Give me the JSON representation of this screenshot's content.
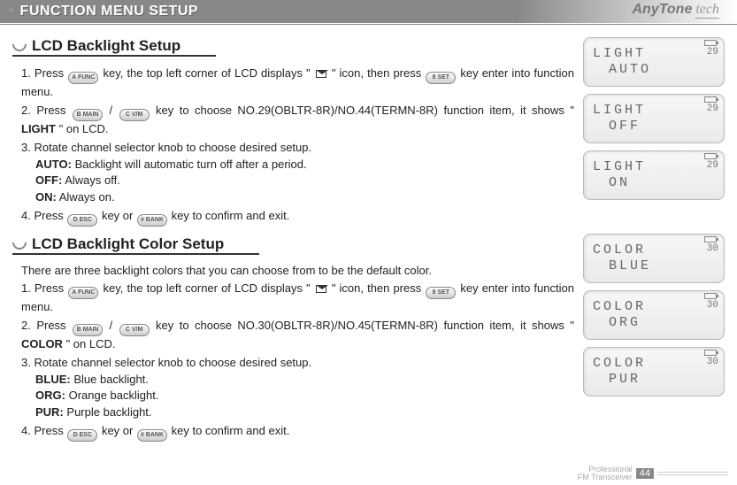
{
  "header": {
    "title": "FUNCTION MENU SETUP",
    "brand_main": "AnyTone",
    "brand_sub": "tech"
  },
  "section1": {
    "title": "LCD Backlight Setup",
    "steps": [
      {
        "num": "1.",
        "pre": "Press ",
        "key1": "A FUNC",
        "mid": " key, the top left corner of LCD displays \" ",
        "post": " \" icon, then press ",
        "key2": "8 SET",
        "tail": " key enter into function menu."
      },
      {
        "num": "2.",
        "pre": "Press ",
        "key1": "B MAIN",
        "sep": " / ",
        "key2": "C V/M",
        "post": " key to choose NO.29(OBLTR-8R)/NO.44(TERMN-8R) function item, it shows \"",
        "bold": "LIGHT",
        "tail": "\" on LCD."
      },
      {
        "num": "3.",
        "text": "Rotate channel selector knob to choose desired setup."
      },
      {
        "label": "AUTO:",
        "text": " Backlight will automatic turn off after a period."
      },
      {
        "label": "OFF:",
        "text": " Always off."
      },
      {
        "label": "ON:",
        "text": " Always on."
      },
      {
        "num": "4.",
        "pre": "Press ",
        "key1": "D ESC",
        "mid": " key or ",
        "key2": "# BANK",
        "tail": " key to confirm and exit."
      }
    ]
  },
  "section2": {
    "title": "LCD Backlight Color Setup",
    "intro": "There are three backlight colors that you can choose from to be the default color.",
    "steps": [
      {
        "num": "1.",
        "pre": "Press ",
        "key1": "A FUNC",
        "mid": " key, the top left corner of LCD displays \" ",
        "post": " \" icon, then press ",
        "key2": "8 SET",
        "tail": " key enter into function menu."
      },
      {
        "num": "2.",
        "pre": "Press ",
        "key1": "B MAIN",
        "sep": " / ",
        "key2": "C V/M",
        "post": " key to choose NO.30(OBLTR-8R)/NO.45(TERMN-8R) function item, it shows \"",
        "bold": "COLOR",
        "tail": "\" on LCD."
      },
      {
        "num": "3.",
        "text": "Rotate channel selector knob to choose desired setup."
      },
      {
        "label": "BLUE:",
        "text": " Blue backlight."
      },
      {
        "label": "ORG:",
        "text": " Orange backlight."
      },
      {
        "label": "PUR:",
        "text": " Purple backlight."
      },
      {
        "num": "4.",
        "pre": "Press ",
        "key1": "D ESC",
        "mid": " key or ",
        "key2": "# BANK",
        "tail": " key to confirm and exit."
      }
    ]
  },
  "lcds": [
    {
      "line1": "LIGHT",
      "line2": "AUTO",
      "num": "29"
    },
    {
      "line1": "LIGHT",
      "line2": "OFF",
      "num": "29"
    },
    {
      "line1": "LIGHT",
      "line2": "ON",
      "num": "29"
    },
    {
      "line1": "COLOR",
      "line2": "BLUE",
      "num": "30"
    },
    {
      "line1": "COLOR",
      "line2": "ORG",
      "num": "30"
    },
    {
      "line1": "COLOR",
      "line2": "PUR",
      "num": "30"
    }
  ],
  "footer": {
    "line1": "Professional",
    "line2": "FM Transceiver",
    "page": "44"
  }
}
